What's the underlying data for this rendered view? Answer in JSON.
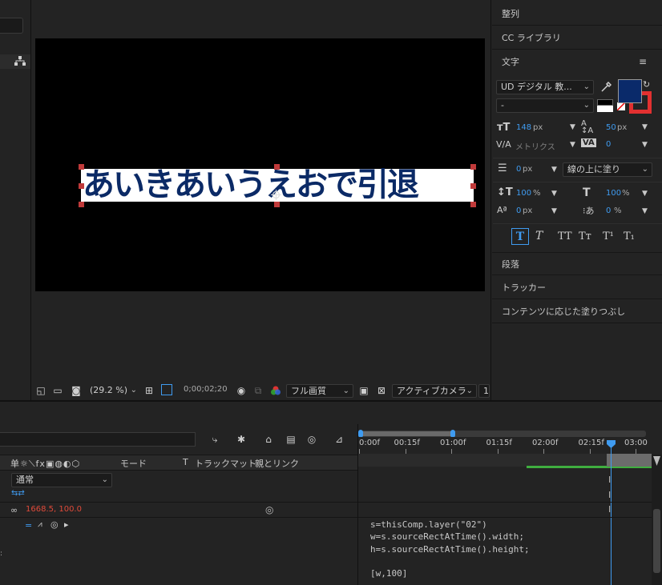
{
  "character_panel": {
    "sections": {
      "align": "整列",
      "cc_libraries": "CC ライブラリ",
      "character": "文字",
      "paragraph": "段落",
      "tracker": "トラッカー",
      "content_aware_fill": "コンテンツに応じた塗りつぶし"
    },
    "font_family": "UD デジタル 教...",
    "font_style": "-",
    "fill_color": "#0a2a6a",
    "stroke_color": "#e23030",
    "font_size": {
      "value": "148",
      "unit": "px"
    },
    "leading": {
      "value": "50",
      "unit": "px"
    },
    "kerning": "メトリクス",
    "tracking": "0",
    "stroke_width": {
      "value": "0",
      "unit": "px"
    },
    "stroke_mode": "線の上に塗り",
    "vertical_scale": {
      "value": "100",
      "unit": "%"
    },
    "horizontal_scale": {
      "value": "100",
      "unit": "%"
    },
    "baseline_shift": {
      "value": "0",
      "unit": "px"
    },
    "tsume": {
      "value": "0",
      "unit": "%"
    },
    "style_buttons": [
      "T",
      "T",
      "TT",
      "Tт",
      "T¹",
      "T₁"
    ]
  },
  "composition": {
    "text": "あいきあいうえおで引退",
    "zoom": "(29.2 %)",
    "timecode": "0;00;02;20",
    "resolution": "フル画質",
    "camera": "アクティブカメラ",
    "views": "1"
  },
  "timeline": {
    "columns": {
      "mode": "モード",
      "track_matte": "トラックマット",
      "parent_link": "親とリンク"
    },
    "layer_mode": "通常",
    "size_value": "1668.5, 100.0",
    "ruler": [
      "0:00f",
      "00:15f",
      "01:00f",
      "01:15f",
      "02:00f",
      "02:15f",
      "03:00"
    ],
    "playhead_fraction": 0.88,
    "expression_lines": [
      "s=thisComp.layer(\"02\")",
      "w=s.sourceRectAtTime().width;",
      "h=s.sourceRectAtTime().height;",
      "",
      "[w,100]"
    ]
  }
}
